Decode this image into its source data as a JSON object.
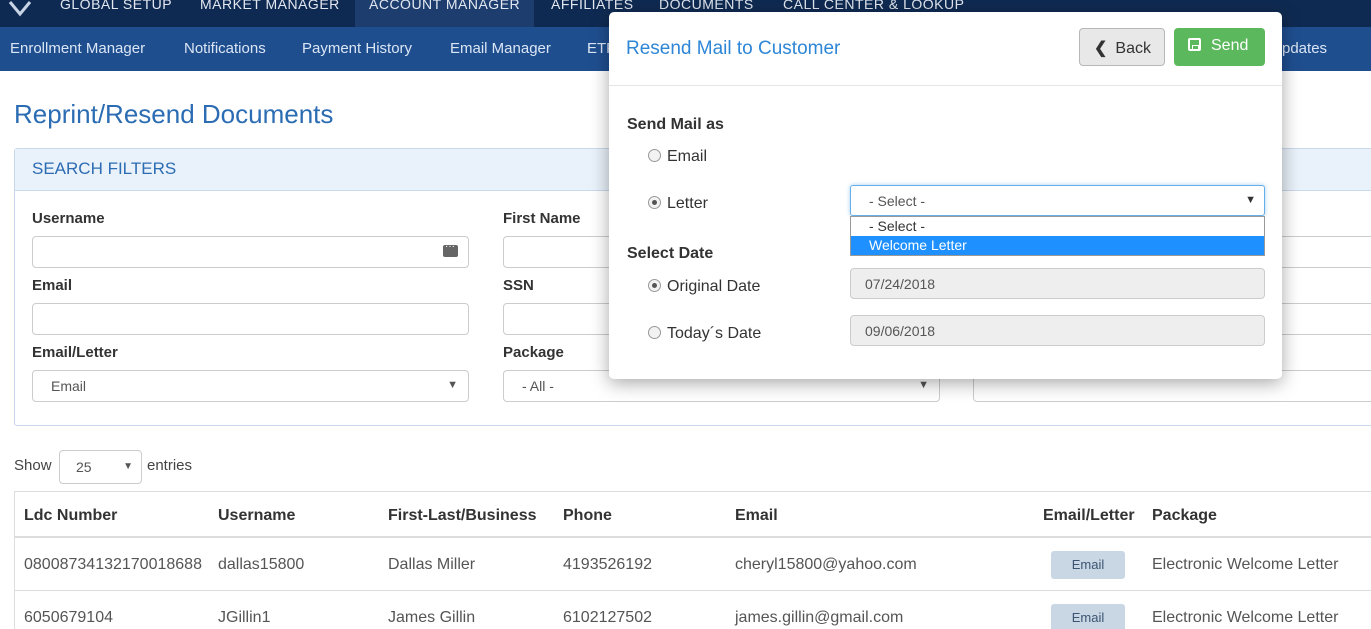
{
  "topnav": {
    "items": [
      "GLOBAL SETUP",
      "MARKET MANAGER",
      "ACCOUNT MANAGER",
      "AFFILIATES",
      "DOCUMENTS",
      "CALL CENTER & LOOKUP"
    ]
  },
  "subnav": {
    "items": [
      "Enrollment Manager",
      "Notifications",
      "Payment History",
      "Email Manager",
      "ETF",
      "pdates"
    ]
  },
  "page": {
    "title": "Reprint/Resend Documents"
  },
  "filters": {
    "header": "SEARCH FILTERS",
    "username_label": "Username",
    "firstname_label": "First Name",
    "email_label": "Email",
    "ssn_label": "SSN",
    "emailletter_label": "Email/Letter",
    "emailletter_value": "Email",
    "package_label": "Package",
    "package_value": "- All -"
  },
  "entries": {
    "show_label": "Show",
    "value": "25",
    "suffix": "entries"
  },
  "table": {
    "columns": [
      "Ldc Number",
      "Username",
      "First-Last/Business",
      "Phone",
      "Email",
      "Email/Letter",
      "Package"
    ],
    "rows": [
      [
        "08008734132170018688",
        "dallas15800",
        "Dallas Miller",
        "4193526192",
        "cheryl15800@yahoo.com",
        "Email",
        "Electronic Welcome Letter"
      ],
      [
        "6050679104",
        "JGillin1",
        "James Gillin",
        "6102127502",
        "james.gillin@gmail.com",
        "Email",
        "Electronic Welcome Letter"
      ]
    ]
  },
  "modal": {
    "title": "Resend Mail to Customer",
    "back_label": "Back",
    "send_label": "Send",
    "send_mail_as_label": "Send Mail as",
    "option_email": "Email",
    "option_letter": "Letter",
    "letter_select_value": "- Select -",
    "letter_options": [
      "- Select -",
      "Welcome Letter"
    ],
    "select_date_label": "Select Date",
    "original_date_label": "Original Date",
    "original_date_value": "07/24/2018",
    "todays_date_label": "Today´s Date",
    "todays_date_value": "09/06/2018"
  }
}
